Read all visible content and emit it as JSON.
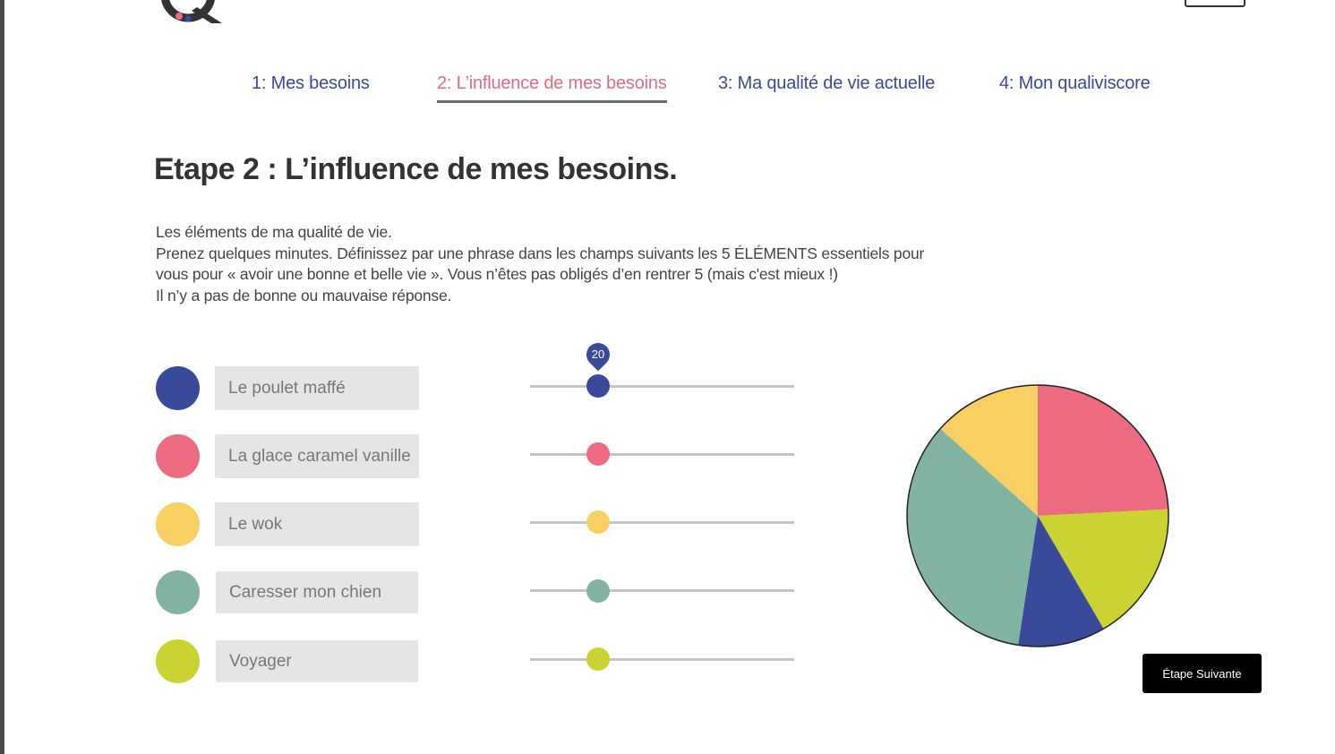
{
  "tabs": [
    {
      "label": "1: Mes besoins",
      "active": false
    },
    {
      "label": "2: L’influence de mes besoins",
      "active": true
    },
    {
      "label": "3: Ma qualité de vie actuelle",
      "active": false
    },
    {
      "label": "4: Mon qualiviscore",
      "active": false
    }
  ],
  "page_title": "Etape 2 : L’influence de mes besoins.",
  "intro": {
    "line1": "Les éléments de ma qualité de vie.",
    "line2": "Prenez quelques minutes. Définissez par une phrase dans les champs suivants les 5 ÉLÉMENTS essentiels pour",
    "line3": "vous pour « avoir une bonne et belle vie ». Vous n’êtes pas obligés d’en rentrer 5 (mais c'est mieux !)",
    "line4": "Il n’y a pas de bonne ou mauvaise réponse."
  },
  "items": [
    {
      "value": "Le poulet maffé",
      "color": "#3a4a9b"
    },
    {
      "value": "La glace caramel vanille",
      "color": "#ec6b80"
    },
    {
      "value": "Le wok",
      "color": "#f7cf62"
    },
    {
      "value": "Caresser mon chien",
      "color": "#80b3a1"
    },
    {
      "value": "Voyager",
      "color": "#cbd333"
    }
  ],
  "slider_tooltip": "20",
  "next_button": "Étape Suivante",
  "chart_data": {
    "type": "pie",
    "slices": [
      {
        "color": "#ec6b80",
        "percent": 24.2
      },
      {
        "color": "#cbd333",
        "percent": 17.4
      },
      {
        "color": "#3a4a9b",
        "percent": 10.8
      },
      {
        "color": "#80b3a1",
        "percent": 34.2
      },
      {
        "color": "#f7cf62",
        "percent": 13.4
      }
    ]
  }
}
